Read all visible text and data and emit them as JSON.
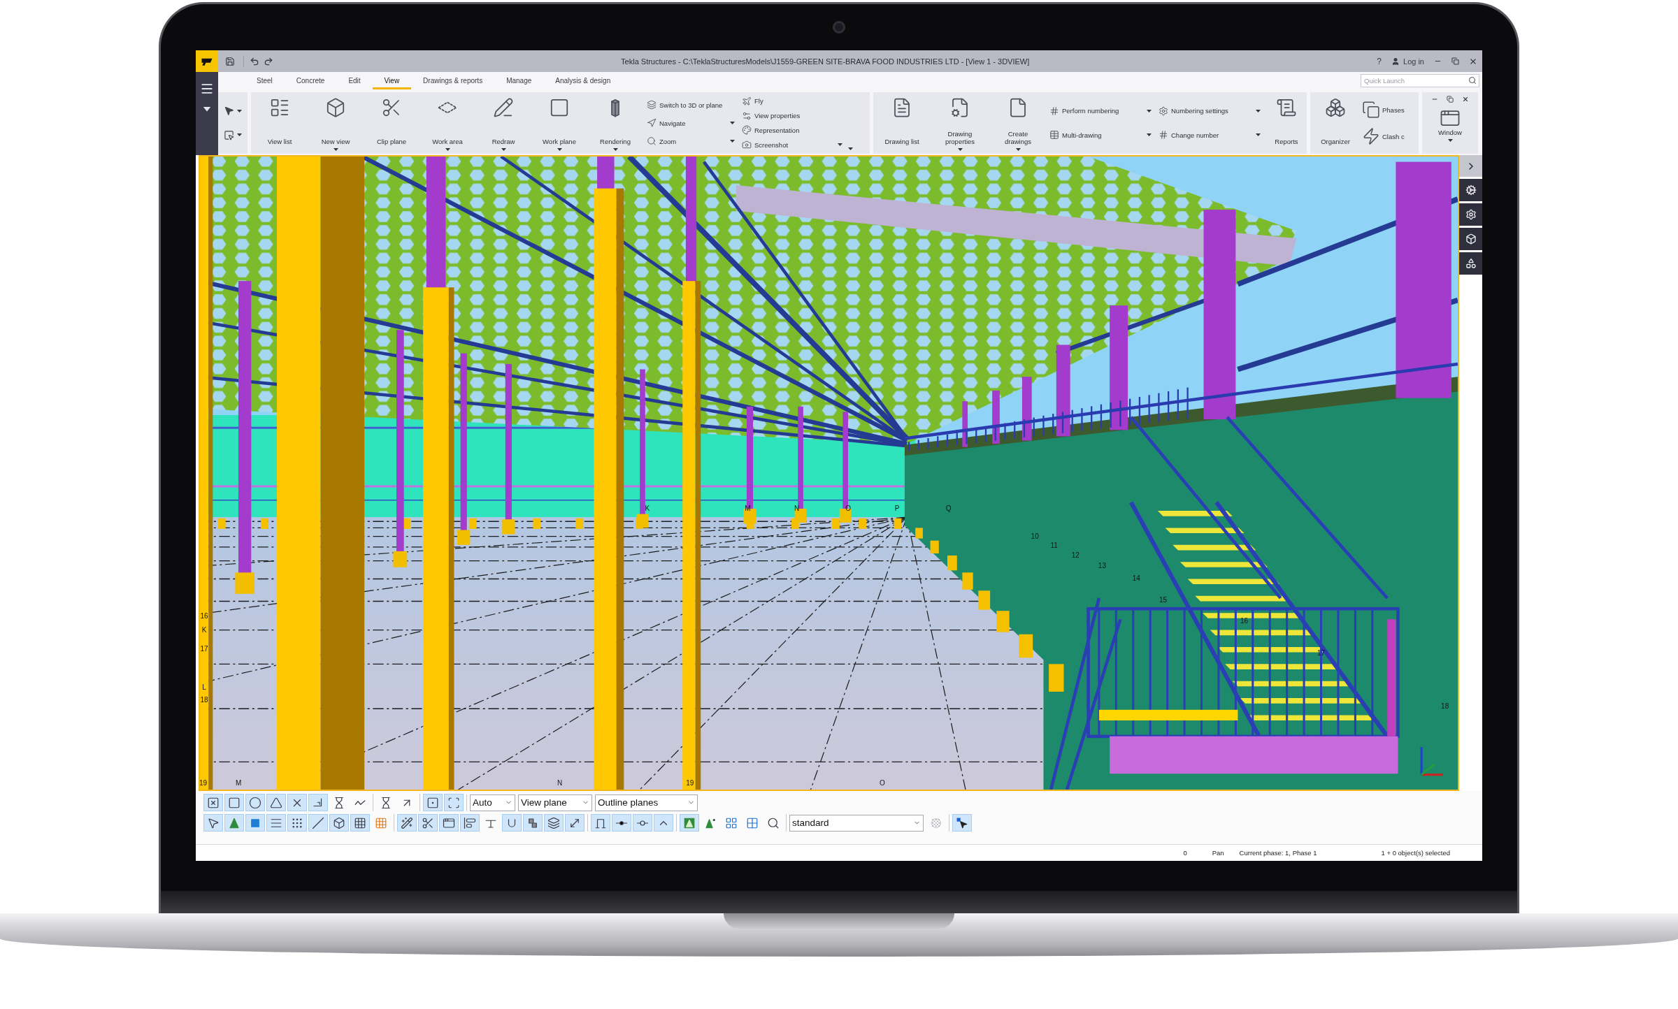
{
  "title_bar": {
    "title": "Tekla Structures - C:\\TeklaStructuresModels\\J1559-GREEN SITE-BRAVA FOOD INDUSTRIES LTD - [View 1 - 3DVIEW]",
    "help": "?",
    "login": "Log in"
  },
  "tabs": [
    {
      "label": "Steel",
      "selected": false
    },
    {
      "label": "Concrete",
      "selected": false
    },
    {
      "label": "Edit",
      "selected": false
    },
    {
      "label": "View",
      "selected": true
    },
    {
      "label": "Drawings & reports",
      "selected": false
    },
    {
      "label": "Manage",
      "selected": false
    },
    {
      "label": "Analysis & design",
      "selected": false
    }
  ],
  "quick_launch": {
    "placeholder": "Quick Launch"
  },
  "ribbon": {
    "groups": [
      {
        "kind": "commands",
        "menu": true,
        "items": [
          {
            "kind": "large",
            "label": "View list",
            "dropdown": false
          },
          {
            "kind": "large",
            "label": "New view",
            "dropdown": true
          },
          {
            "kind": "large",
            "label": "Clip plane",
            "dropdown": false
          },
          {
            "kind": "large",
            "label": "Work area",
            "dropdown": true
          },
          {
            "kind": "large",
            "label": "Redraw",
            "dropdown": true
          },
          {
            "kind": "large",
            "label": "Work plane",
            "dropdown": true
          },
          {
            "kind": "large",
            "label": "Rendering",
            "dropdown": true
          },
          {
            "kind": "column",
            "items": [
              {
                "label": "Switch to 3D or plane",
                "dropdown": false
              },
              {
                "label": "Navigate",
                "dropdown": true
              },
              {
                "label": "Zoom",
                "dropdown": true
              }
            ]
          },
          {
            "kind": "column",
            "items": [
              {
                "label": "Fly",
                "dropdown": false
              },
              {
                "label": "View properties",
                "dropdown": false
              },
              {
                "label": "Representation",
                "dropdown": false
              },
              {
                "label": "Screenshot",
                "dropdown": true
              }
            ]
          }
        ]
      },
      {
        "kind": "commands",
        "menu": false,
        "items": [
          {
            "kind": "large",
            "label": "Drawing list",
            "dropdown": false
          },
          {
            "kind": "large",
            "label": "Drawing properties",
            "dropdown": true
          },
          {
            "kind": "large",
            "label": "Create drawings",
            "dropdown": true
          },
          {
            "kind": "column",
            "items": [
              {
                "label": "Perform numbering",
                "dropdown": true
              },
              {
                "label": "Multi-drawing",
                "dropdown": true
              }
            ]
          },
          {
            "kind": "column",
            "items": [
              {
                "label": "Numbering settings",
                "dropdown": true
              },
              {
                "label": "Change number",
                "dropdown": true
              }
            ]
          },
          {
            "kind": "large",
            "label": "Reports",
            "dropdown": false
          }
        ]
      },
      {
        "kind": "commands",
        "menu": false,
        "items": [
          {
            "kind": "large",
            "label": "Organizer",
            "dropdown": false
          },
          {
            "kind": "stack",
            "items": [
              {
                "label": "Phases"
              },
              {
                "label": "Clash c"
              }
            ]
          }
        ]
      },
      {
        "kind": "window",
        "menu": false,
        "items": [
          {
            "kind": "large",
            "label": "Window",
            "dropdown": true
          }
        ]
      }
    ]
  },
  "model_view": {
    "grid_labels": [
      "19",
      "M",
      "N",
      "19",
      "O",
      "16",
      "K",
      "17",
      "L",
      "18",
      "K",
      "M",
      "N",
      "O",
      "P",
      "Q",
      "10",
      "11",
      "12",
      "13",
      "14",
      "15",
      "16",
      "17",
      "18"
    ]
  },
  "toolbars": [
    {
      "groups": [
        {
          "items": [
            {
              "kind": "toggle",
              "on": true
            },
            {
              "kind": "toggle",
              "on": true
            },
            {
              "kind": "toggle",
              "on": true
            },
            {
              "kind": "toggle",
              "on": true
            },
            {
              "kind": "toggle",
              "on": true
            },
            {
              "kind": "toggle",
              "on": true
            },
            {
              "kind": "toggle",
              "on": false
            },
            {
              "kind": "toggle",
              "on": false
            }
          ]
        },
        {
          "items": [
            {
              "kind": "toggle",
              "on": false
            },
            {
              "kind": "toggle",
              "on": false
            }
          ]
        },
        {
          "items": [
            {
              "kind": "toggle",
              "on": true
            },
            {
              "kind": "toggle",
              "on": true
            }
          ]
        },
        {
          "items": [
            {
              "kind": "dropdown",
              "value": "Auto"
            },
            {
              "kind": "dropdown",
              "value": "View plane"
            },
            {
              "kind": "dropdown",
              "value": "Outline planes"
            }
          ]
        }
      ]
    },
    {
      "groups": [
        {
          "items": [
            {
              "kind": "toggle",
              "on": true
            },
            {
              "kind": "toggle",
              "on": true
            },
            {
              "kind": "toggle",
              "on": true
            },
            {
              "kind": "toggle",
              "on": true
            },
            {
              "kind": "toggle",
              "on": true
            },
            {
              "kind": "toggle",
              "on": true
            },
            {
              "kind": "toggle",
              "on": true
            },
            {
              "kind": "toggle",
              "on": true
            },
            {
              "kind": "toggle",
              "on": false
            }
          ]
        },
        {
          "items": [
            {
              "kind": "toggle",
              "on": true
            },
            {
              "kind": "toggle",
              "on": true
            },
            {
              "kind": "toggle",
              "on": true
            },
            {
              "kind": "toggle",
              "on": true
            },
            {
              "kind": "toggle",
              "on": false
            },
            {
              "kind": "toggle",
              "on": true
            },
            {
              "kind": "toggle",
              "on": true
            },
            {
              "kind": "toggle",
              "on": true
            },
            {
              "kind": "toggle",
              "on": true
            }
          ]
        },
        {
          "items": [
            {
              "kind": "toggle",
              "on": true
            },
            {
              "kind": "toggle",
              "on": true
            },
            {
              "kind": "toggle",
              "on": true
            },
            {
              "kind": "toggle",
              "on": true
            }
          ]
        },
        {
          "items": [
            {
              "kind": "toggle",
              "on": true
            },
            {
              "kind": "toggle",
              "on": false
            },
            {
              "kind": "toggle",
              "on": false
            },
            {
              "kind": "toggle",
              "on": false
            },
            {
              "kind": "toggle",
              "on": false
            }
          ]
        },
        {
          "items": [
            {
              "kind": "dropdown",
              "value": "standard"
            },
            {
              "kind": "toggle",
              "on": false
            }
          ]
        },
        {
          "items": [
            {
              "kind": "toggle",
              "on": true
            }
          ]
        }
      ]
    }
  ],
  "status_bar": [
    "0",
    "Pan",
    "Current phase: 1, Phase 1",
    "1 + 0 object(s) selected"
  ]
}
